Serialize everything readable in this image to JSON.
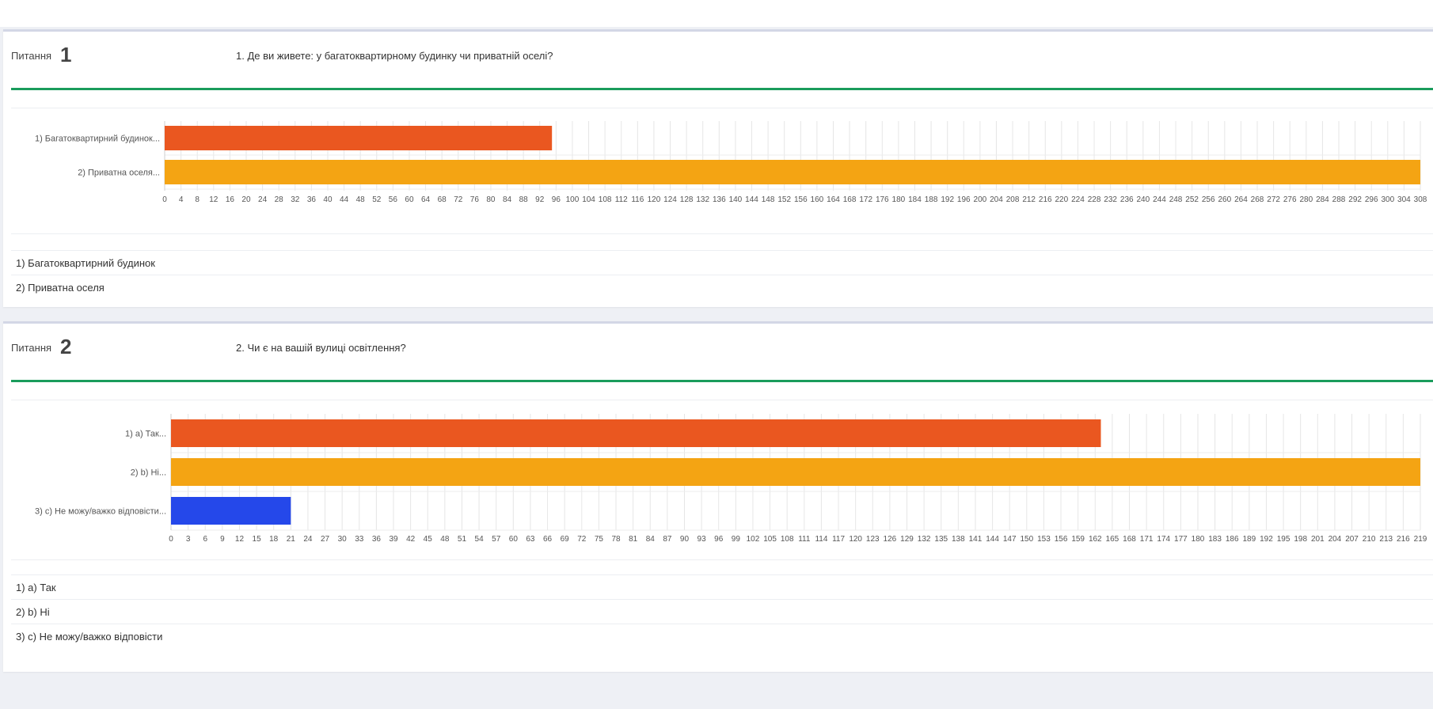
{
  "questions": [
    {
      "label": "Питання",
      "number": "1",
      "text": "1. Де ви живете: у багатоквартирному будинку чи приватній оселі?",
      "answers": [
        "1) Багатоквартирний будинок",
        "2) Приватна оселя"
      ]
    },
    {
      "label": "Питання",
      "number": "2",
      "text": "2. Чи є на вашій вулиці освітлення?",
      "answers": [
        "1) a) Так",
        "2) b) Ні",
        "3) c) Не можу/важко відповісти"
      ]
    }
  ],
  "chart_data": [
    {
      "type": "bar",
      "orientation": "horizontal",
      "categories": [
        "1) Багатоквартирний будинок...",
        "2) Приватна оселя..."
      ],
      "values": [
        95,
        308
      ],
      "colors": [
        "#ea5720",
        "#f4a413"
      ],
      "xlim": [
        0,
        308
      ],
      "tick_step": 4,
      "grid": true
    },
    {
      "type": "bar",
      "orientation": "horizontal",
      "categories": [
        "1) a) Так...",
        "2) b) Ні...",
        "3) c) Не можу/важко відповісти..."
      ],
      "values": [
        163,
        219,
        21
      ],
      "colors": [
        "#ea5720",
        "#f4a413",
        "#2548ea"
      ],
      "xlim": [
        0,
        219
      ],
      "tick_step": 3,
      "grid": true
    }
  ]
}
